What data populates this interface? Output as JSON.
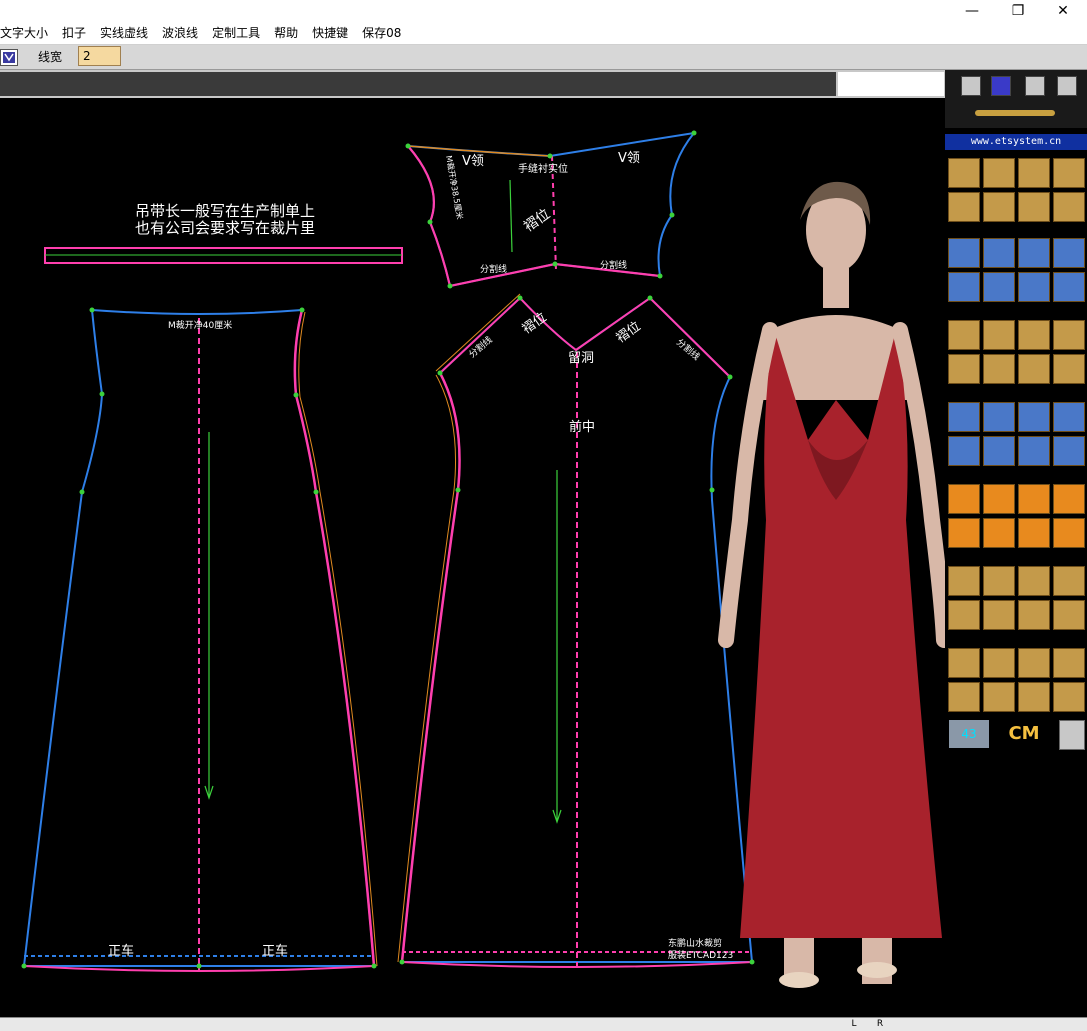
{
  "menu": {
    "items": [
      "文字大小",
      "扣子",
      "实线虚线",
      "波浪线",
      "定制工具",
      "帮助",
      "快捷键",
      "保存08"
    ]
  },
  "window": {
    "minimize_glyph": "—",
    "restore_glyph": "❐",
    "close_glyph": "✕",
    "mdi_minimize": "_",
    "mdi_restore": "▫",
    "mdi_close": "✕"
  },
  "toolbar": {
    "line_width_label": "线宽",
    "line_width_value": "2"
  },
  "pattern": {
    "note_line1": "吊带长一般写在生产制单上",
    "note_line2": "也有公司会要求写在裁片里",
    "back_top_note": "M裁开净40厘米",
    "back_hem_left": "正车",
    "back_hem_right": "正车",
    "front_v_label": "V领",
    "front_pleat_left": "褶位",
    "front_pleat_right": "褶位",
    "front_keep_hole": "留洞",
    "front_center": "前中",
    "front_cut_left": "分割线",
    "front_cut_right": "分割线",
    "yoke_v_left": "V领",
    "yoke_v_right": "V领",
    "yoke_side": "M裁开净38.5厘米",
    "yoke_sew": "手缝衬实位",
    "yoke_pleat": "褶位",
    "yoke_cut_left": "分割线",
    "yoke_cut_right": "分割线",
    "signature_line1": "东鹏山水裁剪",
    "signature_line2": "服装ETCAD123"
  },
  "panel": {
    "website": "www.etsystem.cn",
    "size_number": "43",
    "unit": "CM"
  },
  "status": {
    "left_btn": "L",
    "right_btn": "R"
  },
  "colors": {
    "pink": "#ff3fae",
    "blue": "#2e7fe8",
    "orange": "#e08a20",
    "green": "#3cd23c",
    "dress": "#a8222c"
  }
}
